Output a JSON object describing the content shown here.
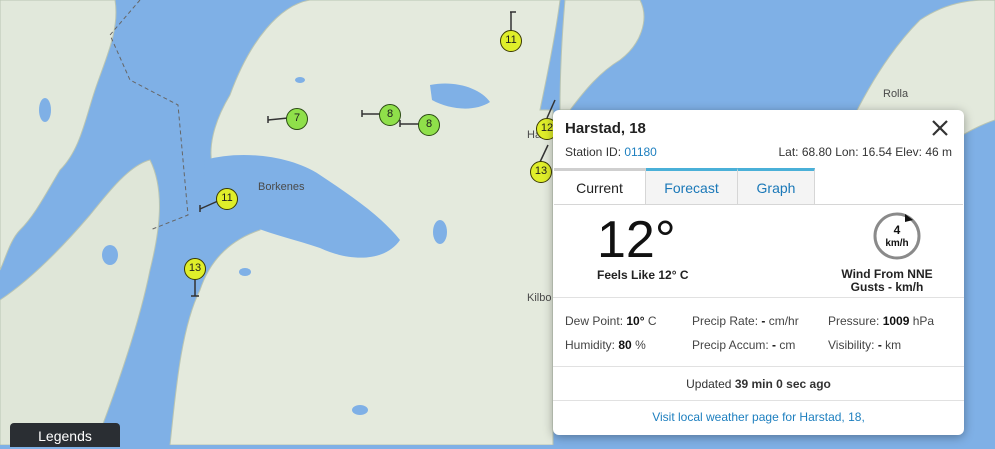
{
  "map": {
    "labels": {
      "borkenes": "Borkenes",
      "rolla": "Rolla",
      "kilbo": "Kilbo",
      "ha": "Ha"
    },
    "stations": [
      {
        "value": "11",
        "color": "yellow"
      },
      {
        "value": "7",
        "color": "green"
      },
      {
        "value": "8",
        "color": "green"
      },
      {
        "value": "8",
        "color": "green"
      },
      {
        "value": "11",
        "color": "yellow"
      },
      {
        "value": "12",
        "color": "yellow"
      },
      {
        "value": "13",
        "color": "yellow"
      },
      {
        "value": "13",
        "color": "yellow"
      }
    ],
    "colors": {
      "water": "#7fb0e6",
      "land": "#e3e9dc",
      "station_yellow": "#dfee2a",
      "station_green": "#8fe04a"
    }
  },
  "legends_label": "Legends",
  "popup": {
    "title": "Harstad, 18",
    "station_id_label": "Station ID:",
    "station_id": "01180",
    "lat_label": "Lat:",
    "lat": "68.80",
    "lon_label": "Lon:",
    "lon": "16.54",
    "elev_label": "Elev:",
    "elev": "46 m",
    "tabs": [
      "Current",
      "Forecast",
      "Graph"
    ],
    "temperature": "12°",
    "feels_like": "Feels Like 12° C",
    "wind_speed": "4",
    "wind_unit": "km/h",
    "wind_from_label": "Wind From",
    "wind_from": "NNE",
    "gusts": "Gusts - km/h",
    "stats": {
      "dew_label": "Dew Point:",
      "dew_value": "10°",
      "dew_unit": "C",
      "humidity_label": "Humidity:",
      "humidity_value": "80",
      "humidity_unit": "%",
      "precip_rate_label": "Precip Rate:",
      "precip_rate_value": "-",
      "precip_rate_unit": "cm/hr",
      "precip_accum_label": "Precip Accum:",
      "precip_accum_value": "-",
      "precip_accum_unit": "cm",
      "pressure_label": "Pressure:",
      "pressure_value": "1009",
      "pressure_unit": "hPa",
      "visibility_label": "Visibility:",
      "visibility_value": "-",
      "visibility_unit": "km"
    },
    "updated_label": "Updated",
    "updated_value": "39 min 0 sec ago",
    "visit_link": "Visit local weather page for Harstad, 18,"
  }
}
